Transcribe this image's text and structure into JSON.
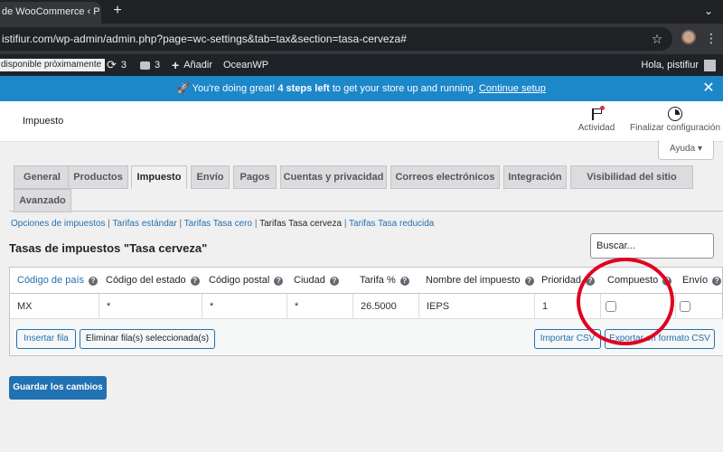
{
  "browser": {
    "tab_title": "de WooCommerce ‹ P",
    "tab_close": "✕",
    "new_tab": "+",
    "url": "istifiur.com/wp-admin/admin.php?page=wc-settings&tab=tax&section=tasa-cerveza#",
    "menu": "⌄"
  },
  "adminbar": {
    "notice_label": "disponible próximamente",
    "updates_count": "3",
    "comments_count": "3",
    "add_label": "Añadir",
    "theme_label": "OceanWP",
    "greeting": "Hola, pistifiur"
  },
  "notice": {
    "text": "🚀 You're doing great!",
    "steps": "4 steps left",
    "text2": "to get your store up and running.",
    "link": "Continue setup",
    "close": "✕"
  },
  "header": {
    "title": "Impuesto",
    "activity_label": "Actividad",
    "finish_label": "Finalizar configuración",
    "help_label": "Ayuda ▾"
  },
  "tabs": [
    {
      "label": "General"
    },
    {
      "label": "Productos"
    },
    {
      "label": "Impuesto"
    },
    {
      "label": "Envío"
    },
    {
      "label": "Pagos"
    },
    {
      "label": "Cuentas y privacidad"
    },
    {
      "label": "Correos electrónicos"
    },
    {
      "label": "Integración"
    },
    {
      "label": "Visibilidad del sitio"
    },
    {
      "label": "Avanzado"
    }
  ],
  "subsub": {
    "opciones": "Opciones de impuestos",
    "estandar": "Tarifas estándar",
    "cero": "Tarifas Tasa cero",
    "cerveza": "Tarifas Tasa cerveza",
    "reducida": "Tarifas Tasa reducida",
    "sep": "|"
  },
  "section_title": "Tasas de impuestos \"Tasa cerveza\"",
  "search_placeholder": "Buscar...",
  "table": {
    "headers": {
      "country": "Código de país",
      "state": "Código del estado",
      "postcode": "Código postal",
      "city": "Ciudad",
      "rate": "Tarifa %",
      "name": "Nombre del impuesto",
      "priority": "Prioridad",
      "compound": "Compuesto",
      "shipping": "Envío"
    },
    "row": {
      "country": "MX",
      "state": "*",
      "postcode": "*",
      "city": "*",
      "rate": "26.5000",
      "name": "IEPS",
      "priority": "1",
      "compound": false,
      "shipping": false
    },
    "buttons": {
      "insert": "Insertar fila",
      "delete": "Eliminar fila(s) seleccionada(s)",
      "import": "Importar CSV",
      "export": "Exportar en formato CSV"
    }
  },
  "save_label": "Guardar los cambios",
  "help_q": "?"
}
